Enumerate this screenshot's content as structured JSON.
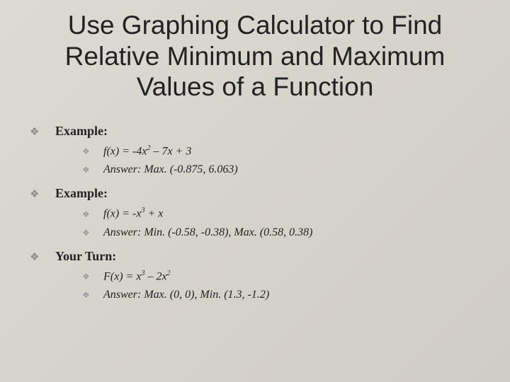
{
  "title": "Use Graphing Calculator to Find Relative Minimum and Maximum Values of a Function",
  "sections": [
    {
      "heading": "Example:",
      "items": [
        {
          "html": "f(x) = -4x<sup>2</sup> – 7x + 3"
        },
        {
          "html": "Answer: Max. (-0.875, 6.063)"
        }
      ]
    },
    {
      "heading": "Example:",
      "items": [
        {
          "html": "f(x) = -x<sup>3</sup> + x"
        },
        {
          "html": "Answer: Min. (-0.58, -0.38), Max. (0.58, 0.38)"
        }
      ]
    },
    {
      "heading": "Your Turn:",
      "items": [
        {
          "html": "F(x) = x<sup>3</sup> – 2x<sup>2</sup>"
        },
        {
          "html": "Answer: Max. (0, 0), Min. (1.3, -1.2)"
        }
      ]
    }
  ],
  "bullet_glyph": "❖"
}
